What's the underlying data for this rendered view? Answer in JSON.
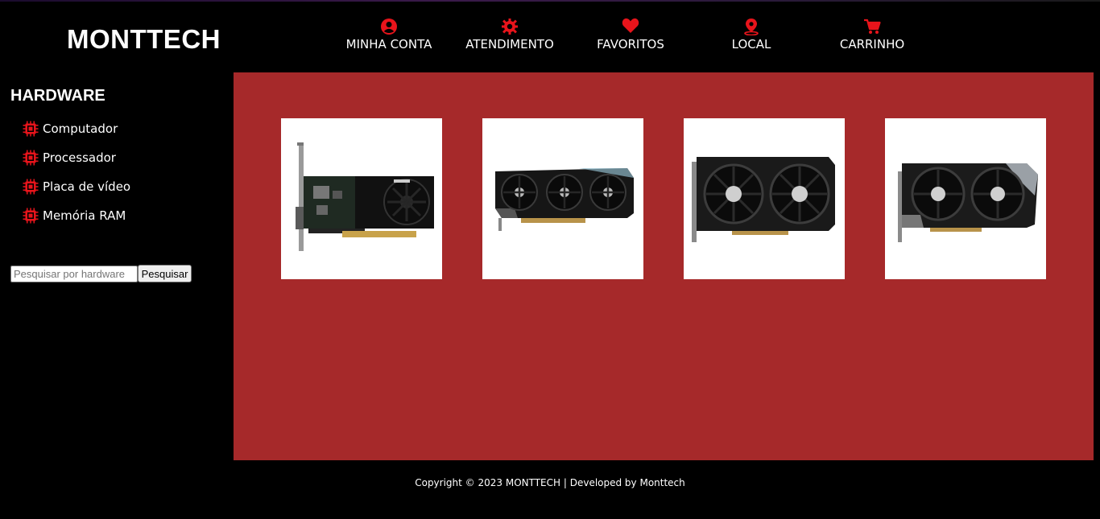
{
  "brand": {
    "name": "MONTTECH"
  },
  "nav": [
    {
      "label": "MINHA CONTA",
      "icon": "user-circle-icon"
    },
    {
      "label": "ATENDIMENTO",
      "icon": "support-gear-icon"
    },
    {
      "label": "FAVORITOS",
      "icon": "heart-icon"
    },
    {
      "label": "LOCAL",
      "icon": "location-pin-icon"
    },
    {
      "label": "CARRINHO",
      "icon": "cart-icon"
    }
  ],
  "sidebar": {
    "title": "HARDWARE",
    "items": [
      {
        "label": "Computador",
        "icon": "chip-icon"
      },
      {
        "label": "Processador",
        "icon": "chip-icon"
      },
      {
        "label": "Placa de vídeo",
        "icon": "chip-icon"
      },
      {
        "label": "Memória RAM",
        "icon": "chip-icon"
      }
    ]
  },
  "search": {
    "placeholder": "Pesquisar por hardware",
    "value": "",
    "button_label": "Pesquisar"
  },
  "products": [
    {
      "image": "low-profile-graphics-card",
      "fans": 1
    },
    {
      "image": "triple-fan-graphics-card",
      "fans": 3
    },
    {
      "image": "dual-fan-graphics-card",
      "fans": 2
    },
    {
      "image": "dual-fan-graphics-card",
      "fans": 2
    }
  ],
  "footer": {
    "text": "Copyright © 2023 MONTTECH | Developed by Monttech"
  },
  "colors": {
    "accent": "#e8141b",
    "main_bg": "#a6292a",
    "page_bg": "#000000"
  }
}
